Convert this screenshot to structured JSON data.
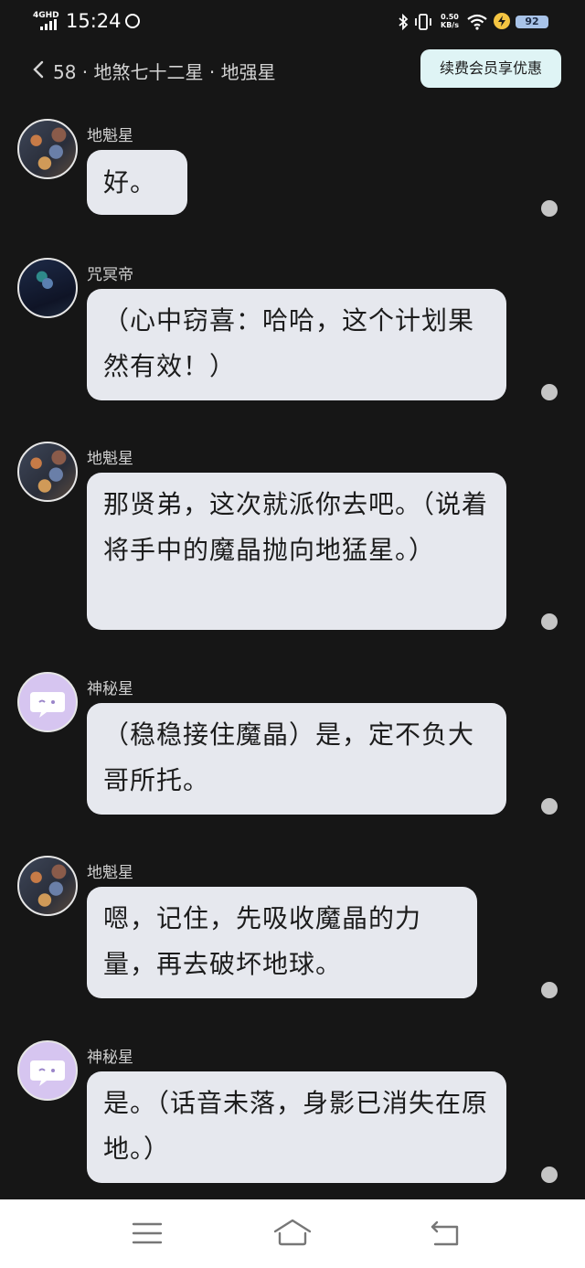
{
  "status_bar": {
    "network": "4GHD",
    "time": "15:24",
    "speed_value": "0.50",
    "speed_unit": "KB/s",
    "battery": "92"
  },
  "header": {
    "back_count": "58",
    "title": "地煞七十二星 · 地强星",
    "vip_button": "续费会员享优惠"
  },
  "messages": [
    {
      "sender": "地魁星",
      "avatar": "dikui-avatar",
      "text": "好。"
    },
    {
      "sender": "咒冥帝",
      "avatar": "zhouming-avatar",
      "text": "（心中窃喜：哈哈，这个计划果然有效！）"
    },
    {
      "sender": "地魁星",
      "avatar": "dikui-avatar",
      "text": "那贤弟，这次就派你去吧。（说着将手中的魔晶抛向地猛星。）"
    },
    {
      "sender": "神秘星",
      "avatar": "shenmi-avatar",
      "text": "（稳稳接住魔晶）是，定不负大哥所托。"
    },
    {
      "sender": "地魁星",
      "avatar": "dikui-avatar",
      "text": "嗯，记住，先吸收魔晶的力量，再去破坏地球。"
    },
    {
      "sender": "神秘星",
      "avatar": "shenmi-avatar",
      "text": "是。（话音未落，身影已消失在原地。）"
    }
  ],
  "nav": {
    "icons": [
      "menu-icon",
      "home-icon",
      "back-icon"
    ]
  },
  "colors": {
    "background": "#161616",
    "bubble": "#e6e8ee",
    "vip_button": "#dff4f5",
    "battery": "#a8c3e8"
  }
}
